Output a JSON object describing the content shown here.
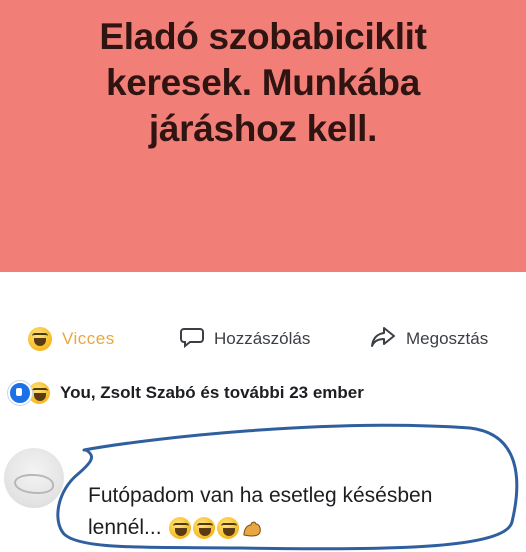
{
  "post": {
    "text": "Eladó szobabiciklit keresek. Munkába járáshoz kell.",
    "background_color": "#f27e78"
  },
  "actions": {
    "like_label": "Vicces",
    "like_icon": "haha-emoji-icon",
    "comment_label": "Hozzászólás",
    "comment_icon": "speech-bubble-icon",
    "share_label": "Megosztás",
    "share_icon": "share-arrow-icon"
  },
  "reactions": {
    "icons": [
      "like-icon",
      "haha-icon"
    ],
    "summary": "You, Zsolt Szabó és további 23 ember"
  },
  "comment": {
    "text": "Futópadom van ha esetleg késésben lennél...",
    "emojis": [
      "haha-emoji-icon",
      "haha-emoji-icon",
      "haha-emoji-icon",
      "flexed-biceps-icon"
    ],
    "highlight_color": "#2f5f9e"
  }
}
